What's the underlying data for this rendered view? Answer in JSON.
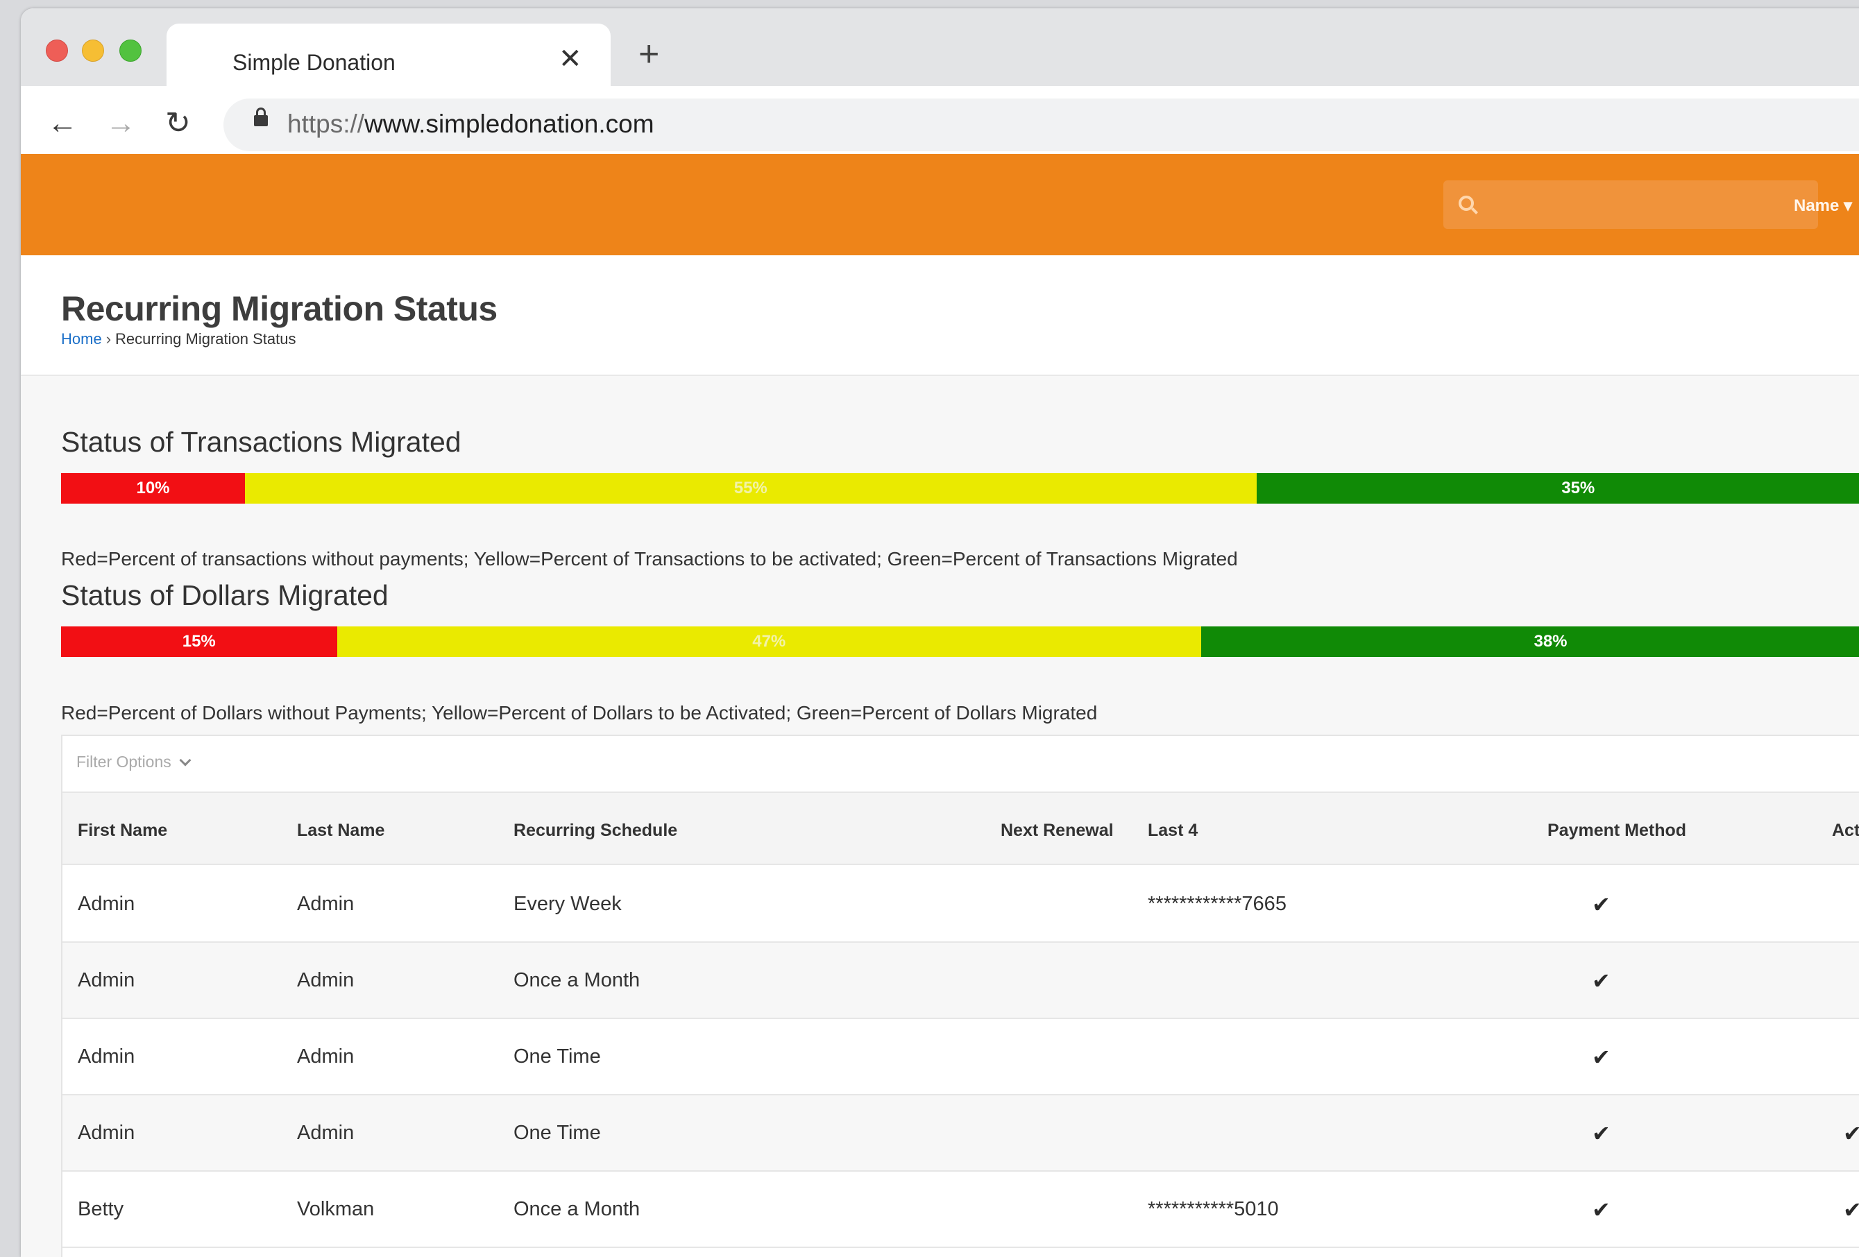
{
  "browser": {
    "tab_title": "Simple Donation",
    "tab_close": "✕",
    "new_tab": "+",
    "url_scheme": "https://",
    "url_host": "www.simpledonation.com"
  },
  "header": {
    "user_menu": "Name ▾"
  },
  "page": {
    "title": "Recurring Migration Status",
    "breadcrumb": {
      "home": "Home",
      "separator": "›",
      "current": "Recurring Migration Status"
    }
  },
  "transactions": {
    "title": "Status of Transactions Migrated",
    "red_label": "10%",
    "red_value": 10,
    "yellow_label": "55%",
    "yellow_value": 55,
    "green_label": "35%",
    "green_value": 35,
    "legend": "Red=Percent of transactions without payments; Yellow=Percent of Transactions to be activated; Green=Percent of Transactions Migrated"
  },
  "dollars": {
    "title": "Status of Dollars Migrated",
    "red_label": "15%",
    "red_value": 15,
    "yellow_label": "47%",
    "yellow_value": 47,
    "green_label": "38%",
    "green_value": 38,
    "legend": "Red=Percent of Dollars without Payments; Yellow=Percent of Dollars to be Activated; Green=Percent of Dollars Migrated"
  },
  "colors": {
    "red": "#f20f14",
    "yellow": "#eaea00",
    "green": "#108a06",
    "brand_orange": "#ee8419"
  },
  "table": {
    "filter_label": "Filter Options",
    "headers": {
      "first_name": "First Name",
      "last_name": "Last Name",
      "schedule": "Recurring Schedule",
      "next_renewal": "Next Renewal",
      "last4": "Last 4",
      "payment_method": "Payment Method",
      "activated": "Activa"
    },
    "rows": [
      {
        "first": "Admin",
        "last": "Admin",
        "schedule": "Every Week",
        "last4": "************7665",
        "payment": "✔",
        "activated": ""
      },
      {
        "first": "Admin",
        "last": "Admin",
        "schedule": "Once a Month",
        "last4": "",
        "payment": "✔",
        "activated": ""
      },
      {
        "first": "Admin",
        "last": "Admin",
        "schedule": "One Time",
        "last4": "",
        "payment": "✔",
        "activated": ""
      },
      {
        "first": "Admin",
        "last": "Admin",
        "schedule": "One Time",
        "last4": "",
        "payment": "✔",
        "activated": "✔"
      },
      {
        "first": "Betty",
        "last": "Volkman",
        "schedule": "Once a Month",
        "last4": "***********5010",
        "payment": "✔",
        "activated": "✔"
      }
    ]
  }
}
